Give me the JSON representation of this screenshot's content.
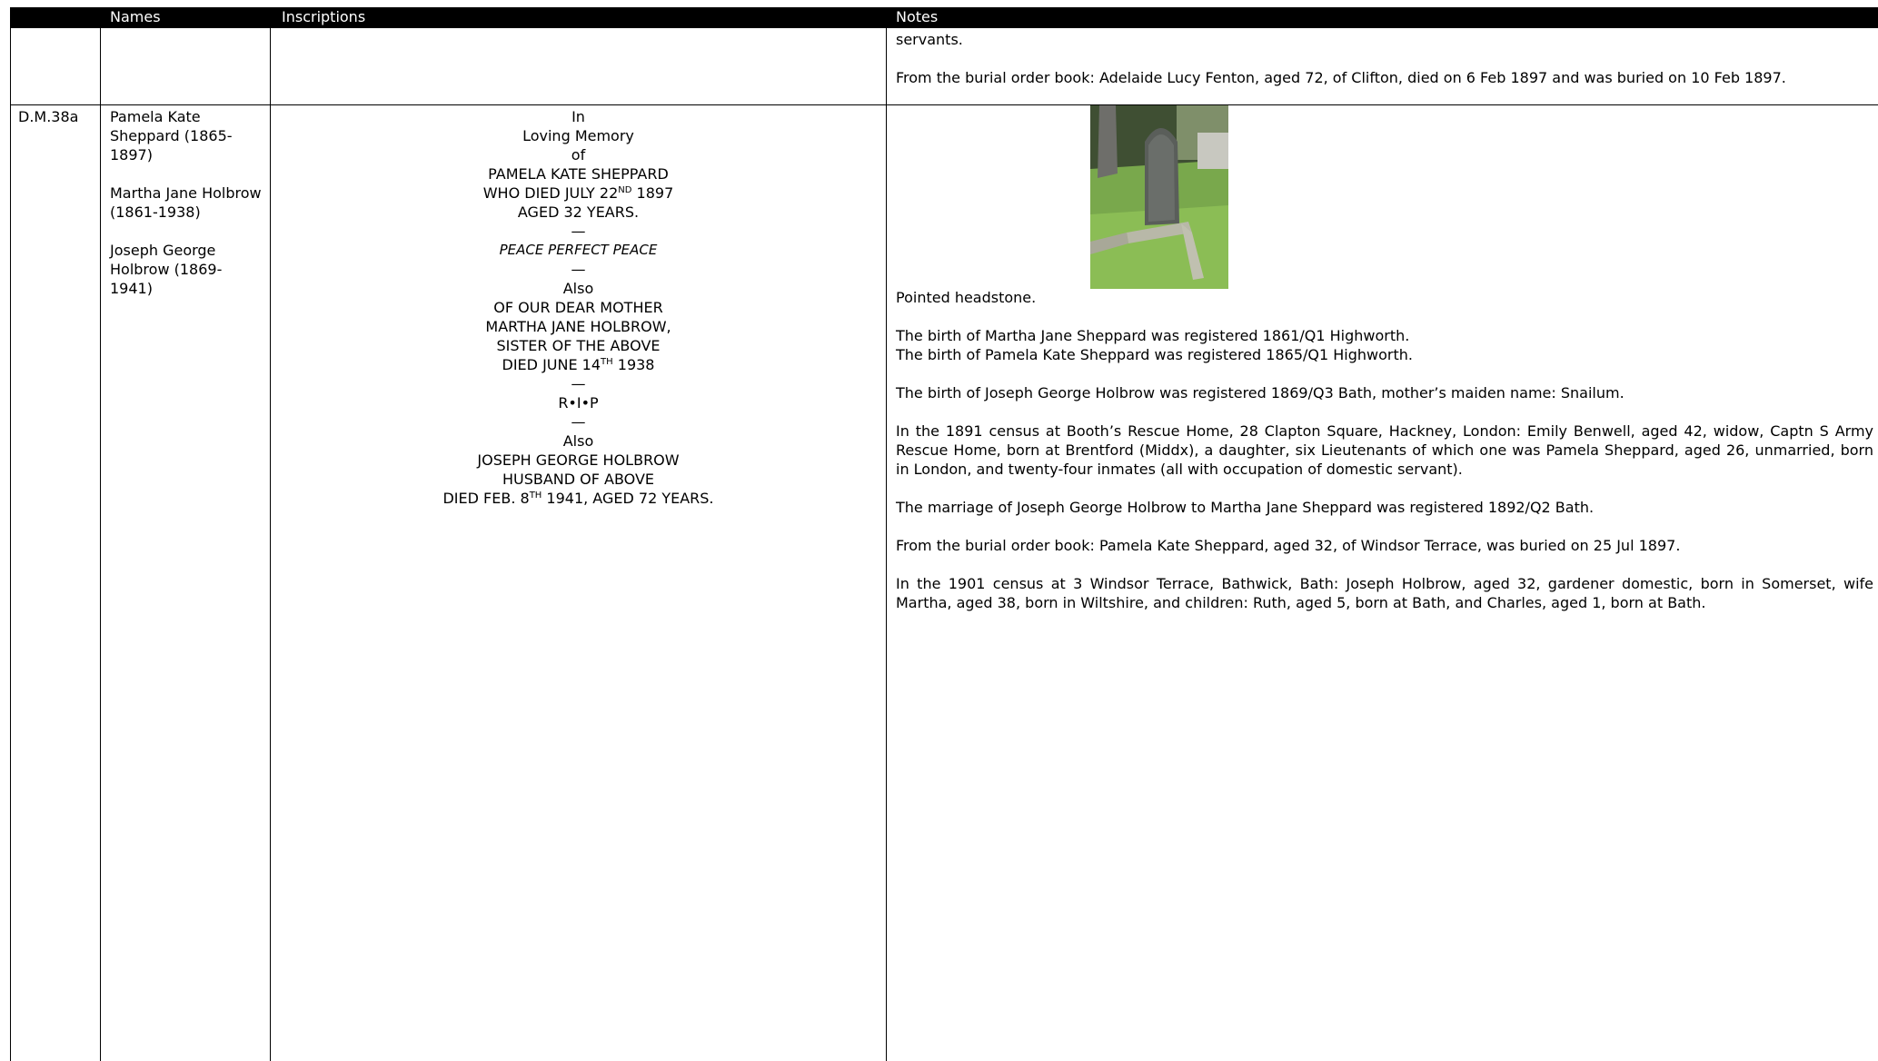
{
  "headers": {
    "names": "Names",
    "inscriptions": "Inscriptions",
    "notes": "Notes"
  },
  "prev_row": {
    "notes_1": "servants.",
    "notes_2": "From the burial order book: Adelaide Lucy Fenton, aged 72, of Clifton, died on 6 Feb 1897 and was buried on 10 Feb 1897."
  },
  "row": {
    "ref": "D.M.38a",
    "names": [
      "Pamela Kate Sheppard (1865-1897)",
      "Martha Jane Holbrow (1861-1938)",
      "Joseph George Holbrow (1869-1941)"
    ],
    "inscription": {
      "l1": "In",
      "l2": "Loving Memory",
      "l3": "of",
      "l4": "PAMELA KATE SHEPPARD",
      "l5a": "WHO DIED JULY 22",
      "l5sup": "ND",
      "l5b": " 1897",
      "l6": "AGED 32 YEARS.",
      "dash": "—",
      "l7": "PEACE PERFECT PEACE",
      "l8": "Also",
      "l9": "OF OUR DEAR MOTHER",
      "l10": "MARTHA JANE HOLBROW,",
      "l11": "SISTER OF THE ABOVE",
      "l12a": "DIED JUNE 14",
      "l12sup": "TH",
      "l12b": " 1938",
      "l13": "R•I•P",
      "l14": "Also",
      "l15": "JOSEPH GEORGE HOLBROW",
      "l16": "HUSBAND OF ABOVE",
      "l17a": "DIED FEB. 8",
      "l17sup": "TH",
      "l17b": " 1941, AGED 72 YEARS."
    },
    "notes": [
      "Pointed headstone.",
      "The birth of Martha Jane Sheppard was registered 1861/Q1 Highworth.",
      "The birth of Pamela Kate Sheppard was registered 1865/Q1 Highworth.",
      "The birth of Joseph George Holbrow was registered 1869/Q3 Bath, mother’s maiden name: Snailum.",
      "In the 1891 census at Booth’s Rescue Home, 28 Clapton Square, Hackney, London: Emily Benwell, aged 42, widow, Captn S Army Rescue Home, born at Brentford (Middx), a daughter, six Lieutenants of which one was Pamela Sheppard, aged 26, unmarried, born in London, and twenty-four inmates (all with occupation of domestic servant).",
      "The marriage of Joseph George Holbrow to Martha Jane Sheppard was registered 1892/Q2 Bath.",
      "From the burial order book: Pamela Kate Sheppard, aged 32, of Windsor Terrace, was buried on 25 Jul 1897.",
      "In the 1901 census at 3 Windsor Terrace, Bathwick, Bath: Joseph Holbrow, aged 32, gardener domestic, born in Somerset, wife Martha, aged 38, born in Wiltshire, and children: Ruth, aged 5, born at Bath, and Charles, aged 1, born at Bath."
    ]
  },
  "colors": {
    "header_bg": "#000000",
    "header_text": "#ffffff",
    "grass": "#6a8a4e"
  }
}
